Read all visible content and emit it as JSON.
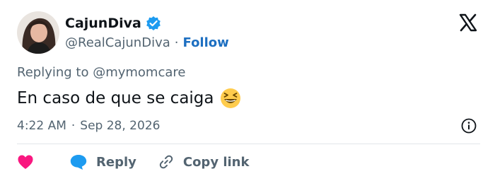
{
  "author": {
    "display_name": "CajunDiva",
    "handle": "@RealCajunDiva",
    "separator": "·",
    "follow_label": "Follow",
    "verified": true
  },
  "tweet": {
    "reply_context": "Replying to @mymomcare",
    "text": "En caso de que se caiga",
    "emoji": "grinning-squinting-face-emoji",
    "time": "4:22 AM",
    "date": "Sep 28, 2026"
  },
  "actions": {
    "reply_label": "Reply",
    "copy_link_label": "Copy link"
  },
  "colors": {
    "accent": "#1d6fc1",
    "verified_badge": "#1d9bf0",
    "heart": "#f91880",
    "reply_icon": "#1d9bf0",
    "muted_text": "#536471",
    "primary_text": "#0f1419"
  },
  "icons": {
    "logo": "x-logo-icon",
    "info": "info-icon",
    "like": "heart-icon",
    "reply": "speech-bubble-icon",
    "copy_link": "link-icon"
  }
}
